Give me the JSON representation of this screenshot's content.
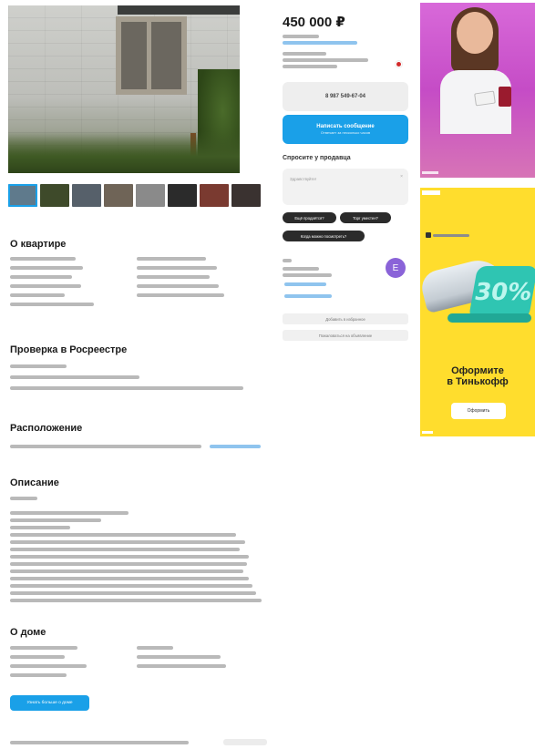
{
  "listing": {
    "price": "450 000 ₽",
    "phone_button": "8 987 549-67-04",
    "message_button": {
      "title": "Написать сообщение",
      "subtitle": "Отвечает за несколько часов"
    },
    "ask_seller": {
      "title": "Спросите у продавца",
      "placeholder": "Здравствуйте!",
      "close": "×",
      "chips": [
        "Ещё продаётся?",
        "Торг уместен?",
        "Когда можно посмотреть?"
      ]
    },
    "seller": {
      "avatar_letter": "Е"
    },
    "extra_buttons": [
      "Добавить в избранное",
      "Пожаловаться на объявление"
    ]
  },
  "photos": {
    "thumb_colors": [
      "#5f7a8c",
      "#3e4a2a",
      "#56606a",
      "#6f6457",
      "#8a8a8a",
      "#2b2b2b",
      "#7a3a30",
      "#3a3230"
    ]
  },
  "sections": {
    "about_apartment": "О квартире",
    "rosreestr": "Проверка в Росреестре",
    "location": "Расположение",
    "description": "Описание",
    "about_house": "О доме"
  },
  "about_house": {
    "button": "Узнать больше о доме"
  },
  "ads": {
    "ad2": {
      "headline_line1": "Оформите",
      "headline_line2": "в Тинькофф",
      "cta": "Оформить",
      "percent": "30%"
    }
  }
}
